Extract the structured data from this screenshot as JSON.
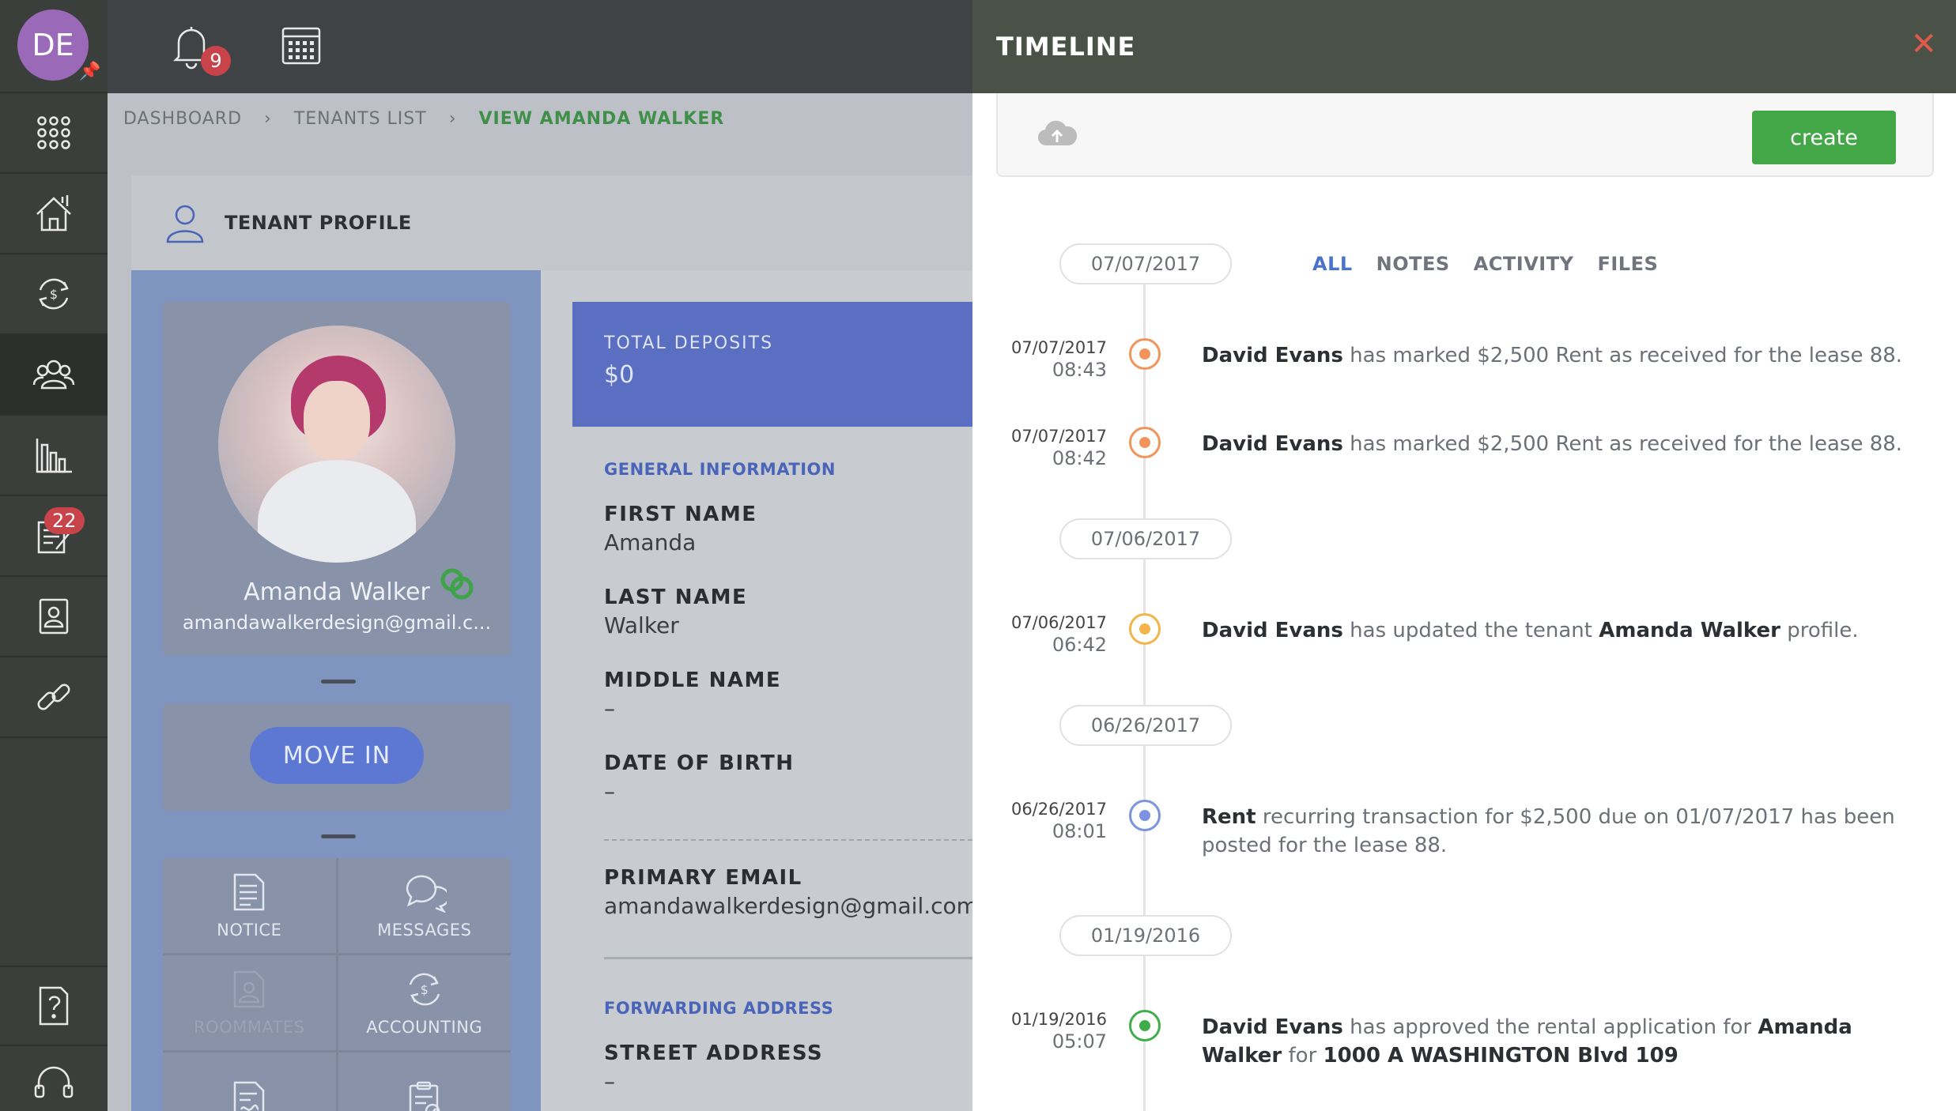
{
  "sidebar": {
    "avatar_initials": "DE",
    "notes_badge": "22"
  },
  "topbar": {
    "notifications_badge": "9"
  },
  "breadcrumb": {
    "items": [
      "DASHBOARD",
      "TENANTS LIST",
      "VIEW AMANDA WALKER"
    ]
  },
  "profile": {
    "section_title": "TENANT PROFILE",
    "name": "Amanda Walker",
    "email_short": "amandawalkerdesign@gmail.c...",
    "move_in_label": "MOVE IN",
    "actions": [
      "NOTICE",
      "MESSAGES",
      "ROOMMATES",
      "ACCOUNTING"
    ],
    "deposits_label": "TOTAL DEPOSITS",
    "deposits_value": "$0",
    "general_info_label": "GENERAL INFORMATION",
    "fields": [
      {
        "label": "FIRST NAME",
        "value": "Amanda"
      },
      {
        "label": "LAST NAME",
        "value": "Walker"
      },
      {
        "label": "MIDDLE NAME",
        "value": "–"
      },
      {
        "label": "DATE OF BIRTH",
        "value": "–"
      }
    ],
    "primary_email_label": "PRIMARY EMAIL",
    "primary_email_value": "amandawalkerdesign@gmail.com",
    "forwarding_label": "FORWARDING ADDRESS",
    "street_label": "STREET ADDRESS",
    "street_value": "–"
  },
  "timeline": {
    "title": "TIMELINE",
    "create_label": "create",
    "filters": [
      "ALL",
      "NOTES",
      "ACTIVITY",
      "FILES"
    ],
    "active_filter": "ALL",
    "date_groups": [
      "07/07/2017",
      "07/06/2017",
      "06/26/2017",
      "01/19/2016"
    ],
    "events": [
      {
        "date": "07/07/2017",
        "time": "08:43",
        "color": "#f0955a",
        "actor": "David Evans",
        "text": " has marked $2,500 Rent as received for the lease 88."
      },
      {
        "date": "07/07/2017",
        "time": "08:42",
        "color": "#f0955a",
        "actor": "David Evans",
        "text": " has marked $2,500 Rent as received for the lease 88."
      },
      {
        "date": "07/06/2017",
        "time": "06:42",
        "color": "#f3b54a",
        "actor": "David Evans",
        "text": " has updated the tenant ",
        "bold2": "Amanda Walker",
        "text2": " profile."
      },
      {
        "date": "06/26/2017",
        "time": "08:01",
        "color": "#7e93e0",
        "actor": "Rent",
        "text": " recurring transaction for $2,500 due on 01/07/2017 has been posted for the lease 88."
      },
      {
        "date": "01/19/2016",
        "time": "05:07",
        "color": "#3fae4a",
        "actor": "David Evans",
        "text": " has approved the rental application for ",
        "bold2": "Amanda Walker",
        "text2": " for ",
        "bold3": "1000 A WASHINGTON Blvd 109"
      }
    ]
  }
}
